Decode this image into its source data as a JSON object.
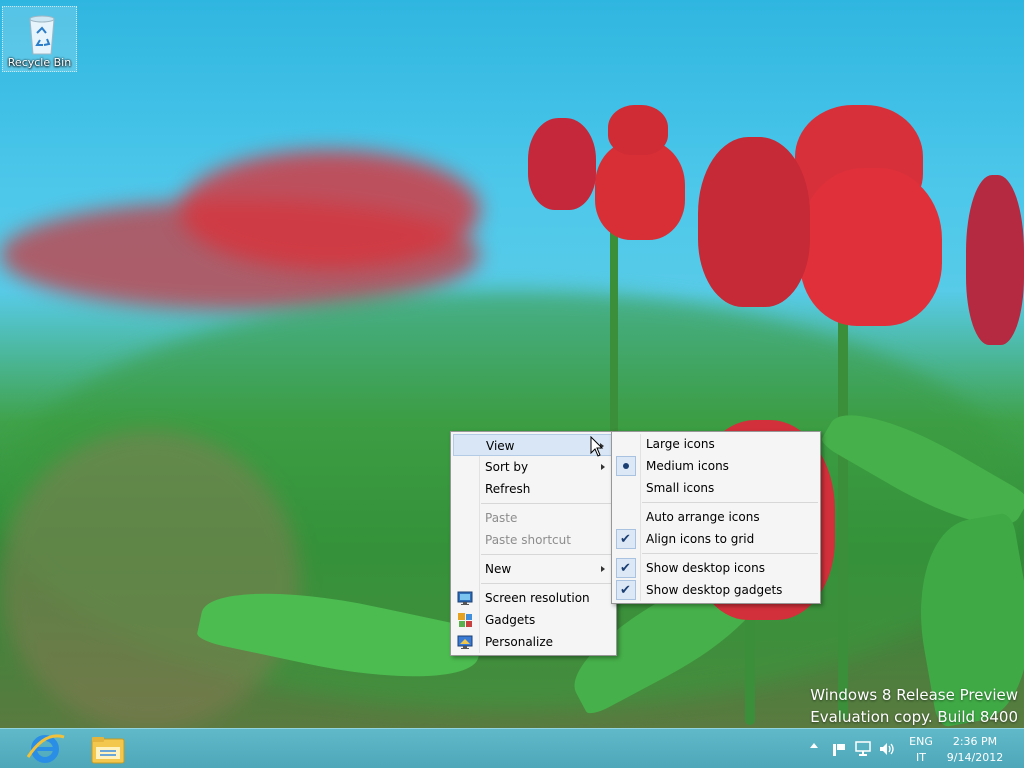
{
  "desktop": {
    "recycle_bin_label": "Recycle Bin",
    "watermark": {
      "line1": "Windows 8 Release Preview",
      "line2": "Evaluation copy. Build 8400"
    }
  },
  "context_menu": {
    "items": [
      {
        "label": "View",
        "has_submenu": true,
        "highlighted": true
      },
      {
        "label": "Sort by",
        "has_submenu": true
      },
      {
        "label": "Refresh"
      },
      {
        "label": "Paste",
        "disabled": true
      },
      {
        "label": "Paste shortcut",
        "disabled": true
      },
      {
        "label": "New",
        "has_submenu": true
      },
      {
        "label": "Screen resolution",
        "icon": "screen-resolution-icon"
      },
      {
        "label": "Gadgets",
        "icon": "gadgets-icon"
      },
      {
        "label": "Personalize",
        "icon": "personalize-icon"
      }
    ]
  },
  "view_submenu": {
    "items": [
      {
        "label": "Large icons"
      },
      {
        "label": "Medium icons",
        "selected": true
      },
      {
        "label": "Small icons"
      },
      {
        "label": "Auto arrange icons"
      },
      {
        "label": "Align icons to grid",
        "checked": true
      },
      {
        "label": "Show desktop icons",
        "checked": true
      },
      {
        "label": "Show desktop gadgets",
        "checked": true
      }
    ]
  },
  "taskbar": {
    "pinned": [
      "internet-explorer-icon",
      "file-explorer-icon"
    ],
    "language_line1": "ENG",
    "language_line2": "IT",
    "time": "2:36 PM",
    "date": "9/14/2012"
  },
  "colors": {
    "taskbar": "#4ea7b8",
    "menu_background": "#f5f5f5",
    "menu_highlight": "#d8e6f5"
  }
}
